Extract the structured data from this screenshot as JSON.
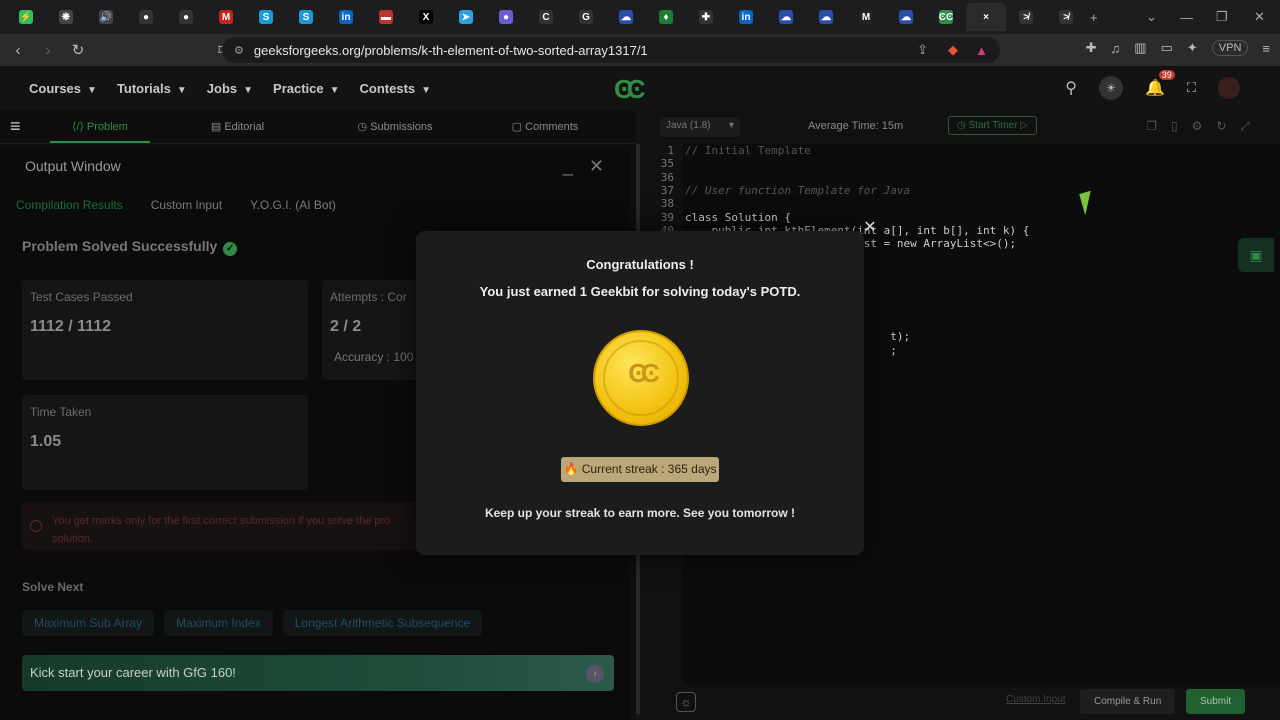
{
  "browser": {
    "url": "geeksforgeeks.org/problems/k-th-element-of-two-sorted-array1317/1",
    "vpn_label": "VPN",
    "tabs": [
      {
        "icon": "lightning-icon",
        "color": "#2fbf5f",
        "glyph": "⚡"
      },
      {
        "icon": "openai-icon",
        "color": "#444",
        "glyph": "❋"
      },
      {
        "icon": "speaker-icon",
        "color": "#444",
        "glyph": "🔊"
      },
      {
        "icon": "github-icon",
        "color": "#333",
        "glyph": "●"
      },
      {
        "icon": "github-icon",
        "color": "#333",
        "glyph": "●"
      },
      {
        "icon": "gmail-icon",
        "color": "#c5221f",
        "glyph": "M"
      },
      {
        "icon": "s-icon",
        "color": "#1a9bd7",
        "glyph": "S"
      },
      {
        "icon": "s-icon",
        "color": "#1a9bd7",
        "glyph": "S"
      },
      {
        "icon": "linkedin-icon",
        "color": "#0a66c2",
        "glyph": "in"
      },
      {
        "icon": "flag-icon",
        "color": "#b33",
        "glyph": "▬"
      },
      {
        "icon": "x-icon",
        "color": "#000",
        "glyph": "X"
      },
      {
        "icon": "telegram-icon",
        "color": "#2aa3df",
        "glyph": "➤"
      },
      {
        "icon": "circle-icon",
        "color": "#6b5bd6",
        "glyph": "●"
      },
      {
        "icon": "c-icon",
        "color": "#333",
        "glyph": "C"
      },
      {
        "icon": "g-icon",
        "color": "#333",
        "glyph": "G"
      },
      {
        "icon": "cloud-icon",
        "color": "#2b4ea8",
        "glyph": "☁"
      },
      {
        "icon": "leaf-icon",
        "color": "#1e7d35",
        "glyph": "♦"
      },
      {
        "icon": "puzzle-icon",
        "color": "#333",
        "glyph": "✚"
      },
      {
        "icon": "linkedin-icon",
        "color": "#0a66c2",
        "glyph": "in"
      },
      {
        "icon": "cloud-icon",
        "color": "#2b4ea8",
        "glyph": "☁"
      },
      {
        "icon": "cloud-icon",
        "color": "#2b4ea8",
        "glyph": "☁"
      },
      {
        "icon": "medium-icon",
        "color": "#222",
        "glyph": "M"
      },
      {
        "icon": "cloud-icon",
        "color": "#2b4ea8",
        "glyph": "☁"
      },
      {
        "icon": "gfg-icon",
        "color": "#2f8d46",
        "glyph": "ϾϾ"
      },
      {
        "icon": "close-tab-icon",
        "color": "#2b2b2e",
        "glyph": "×",
        "active": true
      },
      {
        "icon": "bolt-icon",
        "color": "#333",
        "glyph": "≯"
      },
      {
        "icon": "bolt-icon",
        "color": "#333",
        "glyph": "≯"
      }
    ],
    "new_tab": "+"
  },
  "nav": {
    "menu": [
      "Courses",
      "Tutorials",
      "Jobs",
      "Practice",
      "Contests"
    ],
    "notif_count": "39"
  },
  "subnav": {
    "problem": "Problem",
    "editorial": "Editorial",
    "submissions": "Submissions",
    "comments": "Comments"
  },
  "output": {
    "title": "Output Window",
    "tabs": [
      "Compilation Results",
      "Custom Input",
      "Y.O.G.I. (AI Bot)"
    ],
    "status": "Problem Solved Successfully",
    "test_cases_label": "Test Cases Passed",
    "test_cases_value": "1112 / 1112",
    "attempts_label": "Attempts : Cor",
    "attempts_value": "2 / 2",
    "accuracy": "Accuracy : 100",
    "time_label": "Time Taken",
    "time_value": "1.05",
    "warning_line1": "You get marks only for the first correct submission if you solve the pro",
    "warning_line2": "solution.",
    "solve_next": "Solve Next",
    "next_problems": [
      "Maximum Sub Array",
      "Maximum Index",
      "Longest Arithmetic Subsequence"
    ],
    "career_banner": "Kick start your career with GfG 160!"
  },
  "editor": {
    "language": "Java (1.8)",
    "average_time": "Average Time: 15m",
    "start_timer": "Start Timer",
    "lines": [
      {
        "n": "1",
        "text": "// Initial Template",
        "color": "#555"
      },
      {
        "n": "35",
        "text": "",
        "color": "#ccc"
      },
      {
        "n": "36",
        "text": "",
        "color": "#ccc"
      },
      {
        "n": "37",
        "text": "// User function Template for Java",
        "color": "#555",
        "italic": true
      },
      {
        "n": "38",
        "text": "",
        "color": "#ccc"
      },
      {
        "n": "39",
        "text": "class Solution {",
        "color": "#ccc"
      },
      {
        "n": "40",
        "text": "    public int kthElement(int a[], int b[], int k) {",
        "color": "#ccc"
      },
      {
        "n": "",
        "text": "                          ist = new ArrayList<>();",
        "color": "#ccc"
      },
      {
        "n": "",
        "text": "",
        "color": "#ccc"
      },
      {
        "n": "",
        "text": "",
        "color": "#ccc"
      },
      {
        "n": "",
        "text": "",
        "color": "#ccc"
      },
      {
        "n": "",
        "text": "",
        "color": "#ccc"
      },
      {
        "n": "",
        "text": "",
        "color": "#ccc"
      },
      {
        "n": "",
        "text": "",
        "color": "#ccc"
      },
      {
        "n": "",
        "text": "                               t);",
        "color": "#ccc"
      },
      {
        "n": "",
        "text": "                               ;",
        "color": "#ccc"
      }
    ],
    "custom_input": "Custom Input",
    "compile_run": "Compile & Run",
    "submit": "Submit"
  },
  "modal": {
    "title": "Congratulations !",
    "subtitle": "You just earned 1 Geekbit for solving today's POTD.",
    "streak": "🔥 Current streak : 365 days",
    "footer": "Keep up your streak to earn more. See you tomorrow !"
  }
}
